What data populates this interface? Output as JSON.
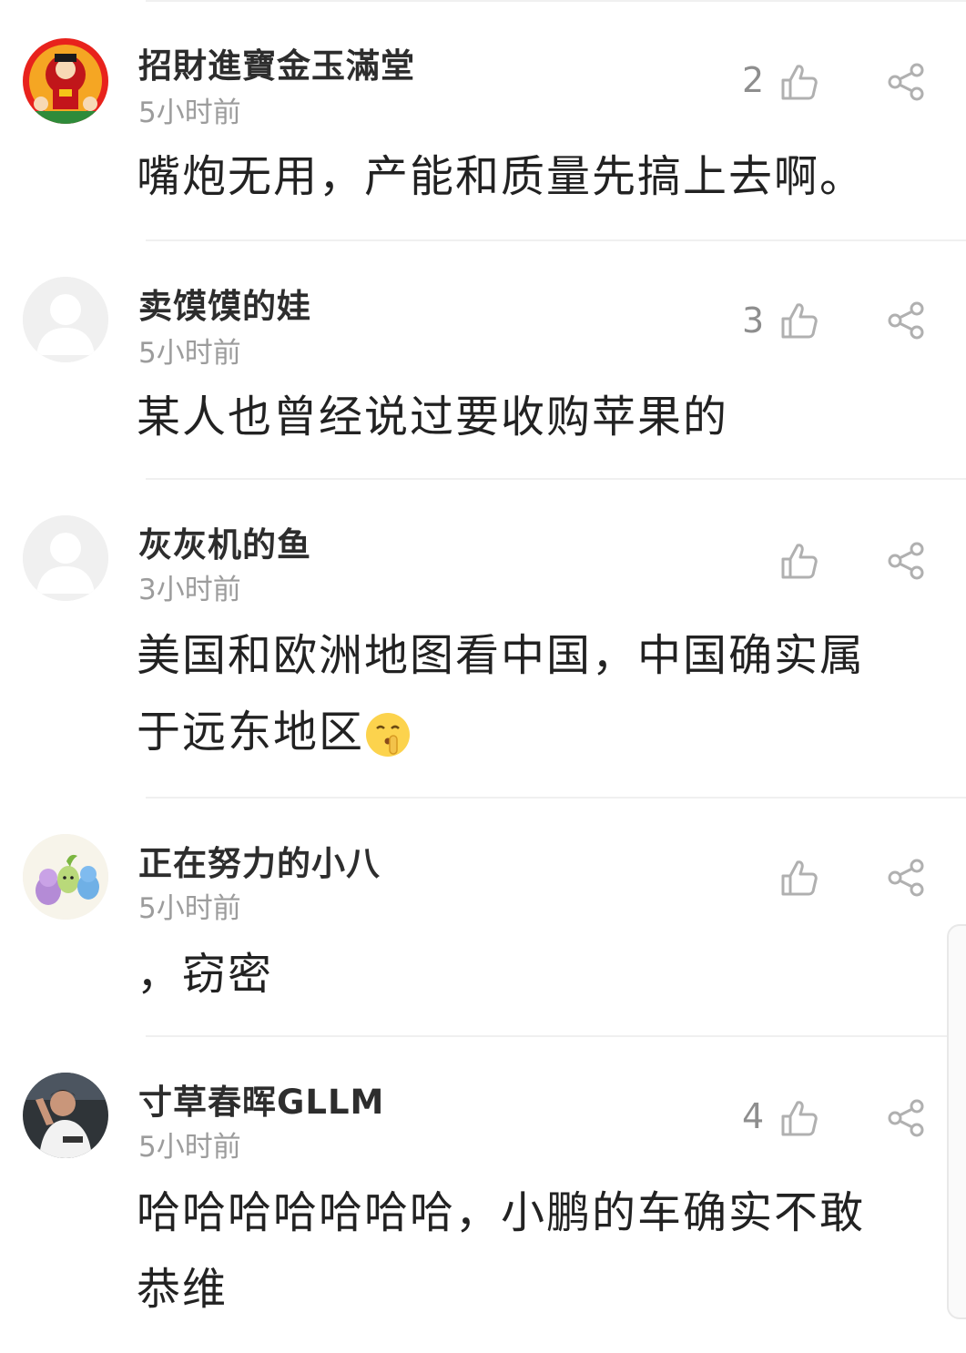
{
  "comments": [
    {
      "username": "招財進寶金玉滿堂",
      "time": "5小时前",
      "likes": "2",
      "content": "嘴炮无用，产能和质量先搞上去啊。",
      "avatar": "deity-avatar"
    },
    {
      "username": "卖馍馍的娃",
      "time": "5小时前",
      "likes": "3",
      "content": "某人也曾经说过要收购苹果的",
      "avatar": "default-avatar"
    },
    {
      "username": "灰灰机的鱼",
      "time": "3小时前",
      "likes": "",
      "content_line1": "美国和欧洲地图看中国，中国确实属",
      "content_line2": "于远东地区",
      "emoji": "shushing-face-emoji",
      "avatar": "default-avatar"
    },
    {
      "username": "正在努力的小八",
      "time": "5小时前",
      "likes": "",
      "content": "，窃密",
      "avatar": "cartoon-avatar"
    },
    {
      "username": "寸草春晖GLLM",
      "time": "5小时前",
      "likes": "4",
      "content_line1": "哈哈哈哈哈哈哈，小鹏的车确实不敢",
      "content_line2": "恭维",
      "avatar": "photo-avatar"
    }
  ],
  "icons": {
    "like": "thumbs-up-icon",
    "share": "share-icon"
  },
  "colors": {
    "username": "#2d2d2d",
    "time": "#9c9c9c",
    "content": "#222222",
    "icon": "#b0b0b0",
    "divider": "#f0f0f0"
  }
}
